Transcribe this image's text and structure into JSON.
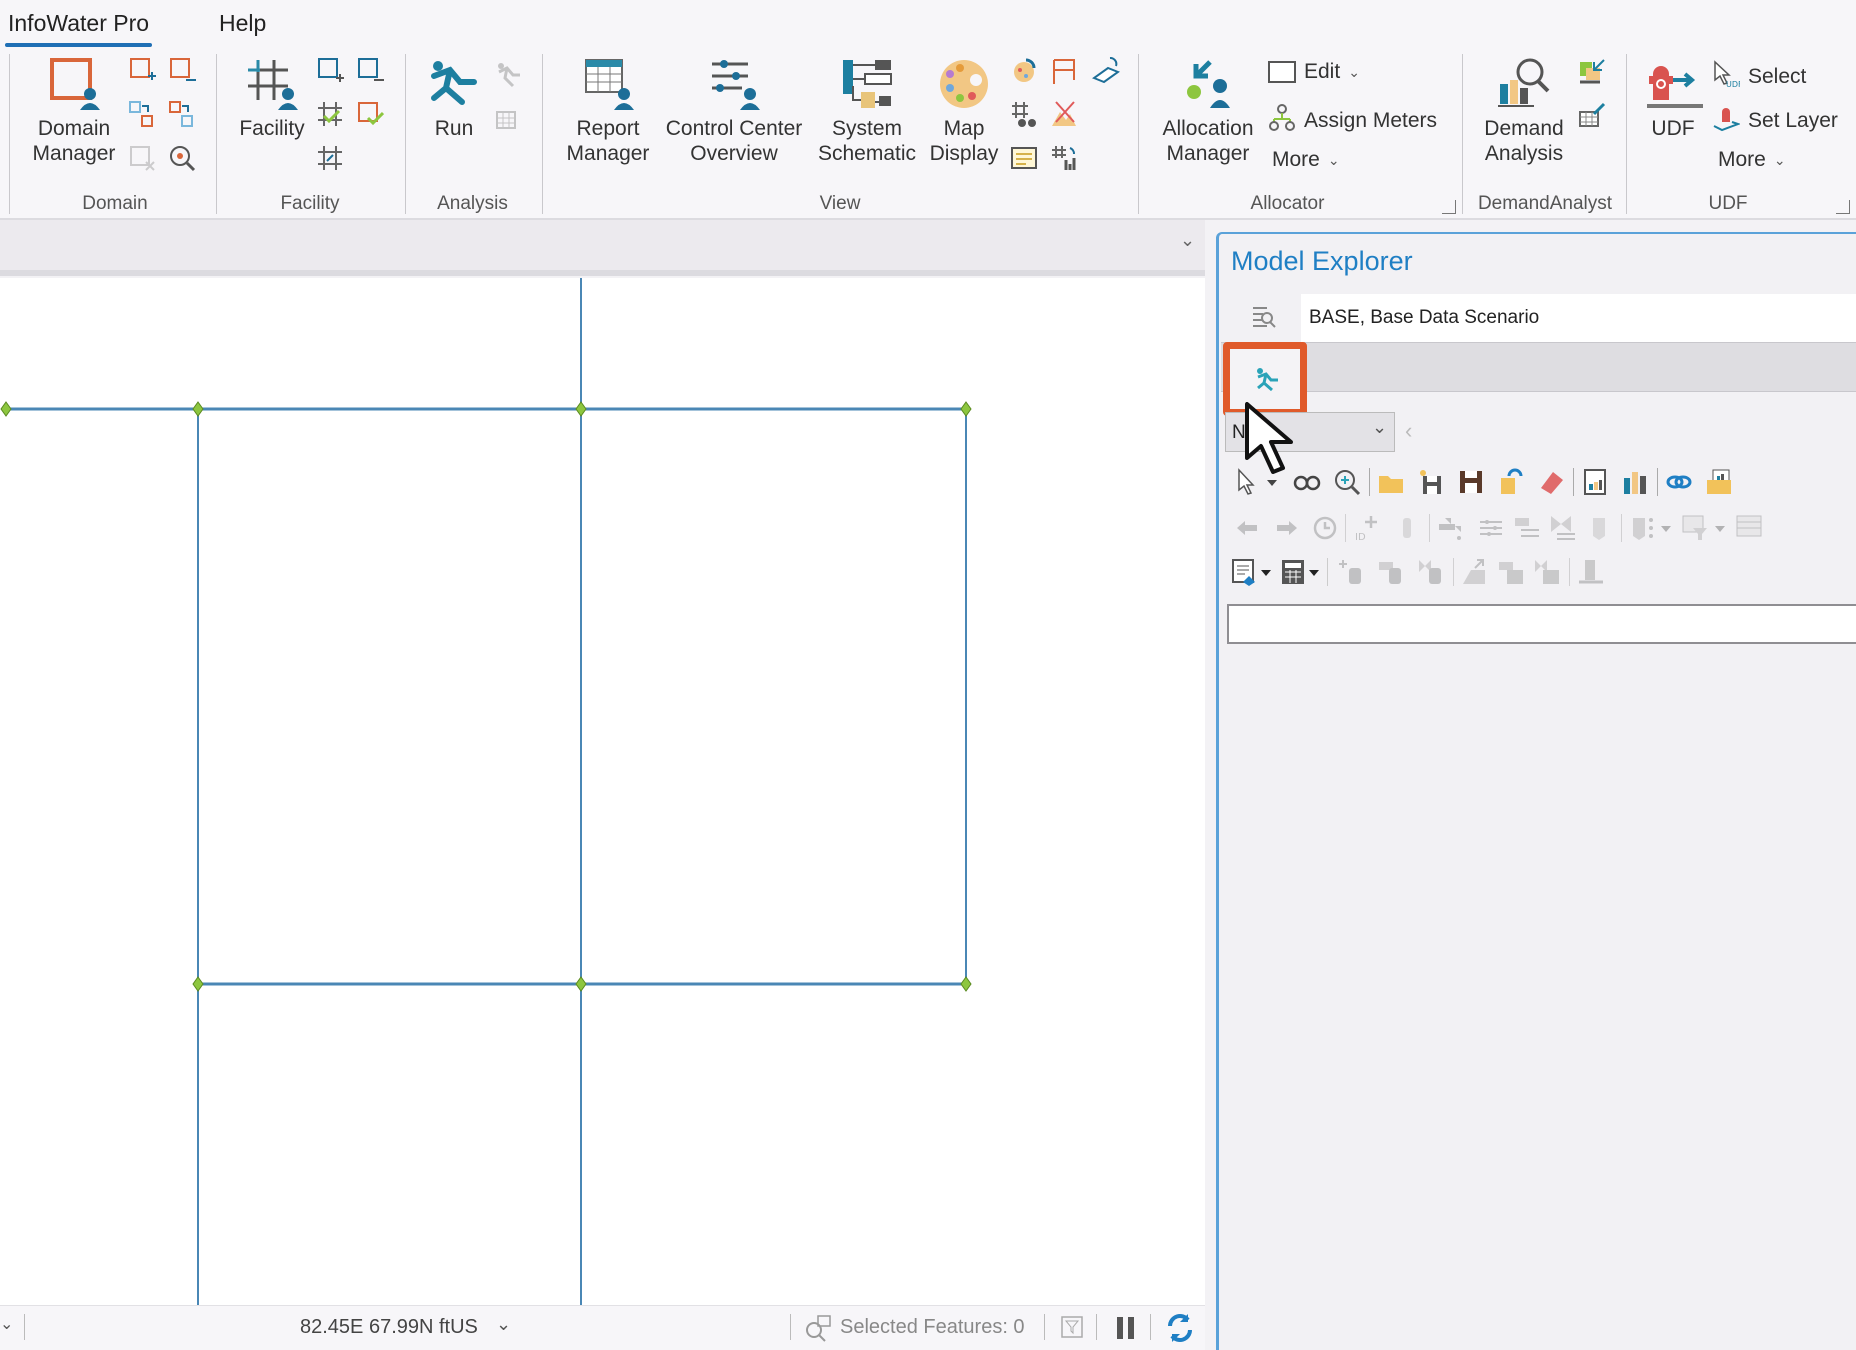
{
  "menu": {
    "tabs": [
      {
        "label": "InfoWater Pro",
        "active": true
      },
      {
        "label": "Help",
        "active": false
      }
    ]
  },
  "ribbon": {
    "groups": {
      "domain": {
        "label": "Domain",
        "big_button": "Domain Manager",
        "big_button_lines": [
          "Domain",
          "Manager"
        ]
      },
      "facility": {
        "label": "Facility",
        "big_button": "Facility"
      },
      "analysis": {
        "label": "Analysis",
        "big_button": "Run"
      },
      "view": {
        "label": "View",
        "buttons": [
          {
            "lines": [
              "Report",
              "Manager"
            ]
          },
          {
            "lines": [
              "Control Center",
              "Overview"
            ]
          },
          {
            "lines": [
              "System",
              "Schematic"
            ]
          },
          {
            "lines": [
              "Map",
              "Display"
            ]
          }
        ]
      },
      "allocator": {
        "label": "Allocator",
        "big_button_lines": [
          "Allocation",
          "Manager"
        ],
        "edit_label": "Edit",
        "assign_meters_label": "Assign Meters",
        "more_label": "More"
      },
      "demand_analyst": {
        "label": "DemandAnalyst",
        "big_button_lines": [
          "Demand",
          "Analysis"
        ]
      },
      "udf": {
        "label": "UDF",
        "big_button": "UDF",
        "select_label": "Select",
        "set_layer_label": "Set Layer",
        "more_label": "More"
      }
    }
  },
  "map": {
    "pipe_color": "#4a87b5",
    "node_color": "#8dc63f"
  },
  "statusbar": {
    "coordinates": "82.45E 67.99N ftUS",
    "selected_features": "Selected Features: 0"
  },
  "model_explorer": {
    "title": "Model Explorer",
    "scenario": "BASE, Base Data Scenario",
    "dropdown_value": "N",
    "highlight_color": "#e05a2a",
    "accent_color": "#1f7fc4"
  }
}
